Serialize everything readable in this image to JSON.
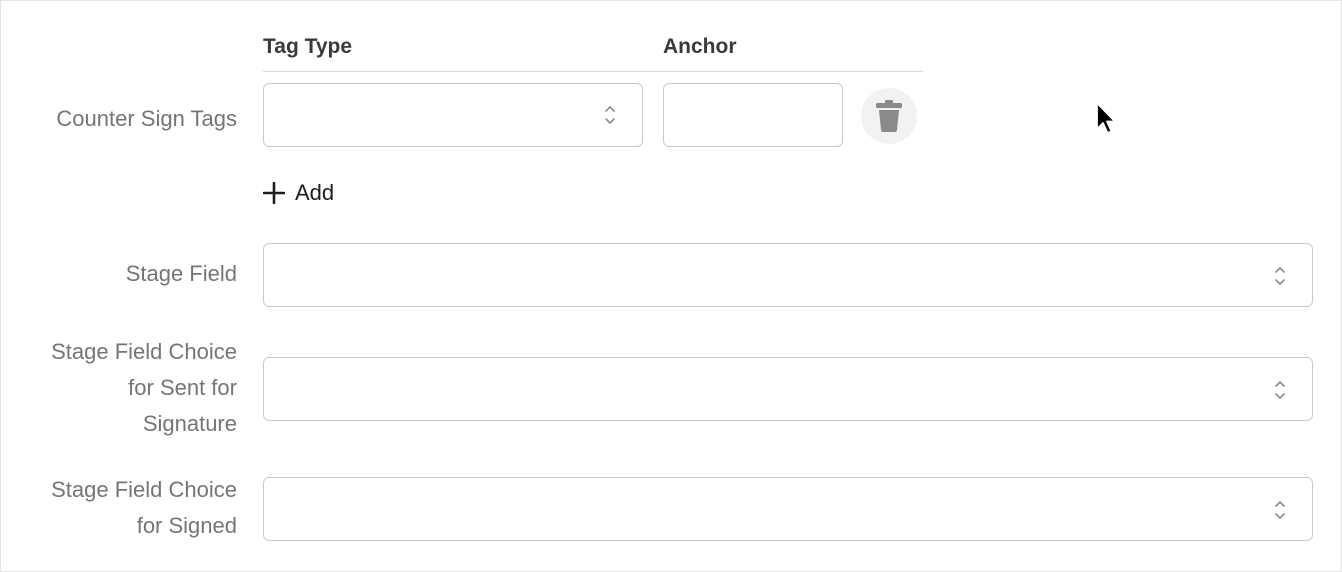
{
  "headers": {
    "tag_type": "Tag Type",
    "anchor": "Anchor"
  },
  "counter_sign": {
    "label": "Counter Sign Tags",
    "tag_type_value": "",
    "anchor_value": ""
  },
  "add_label": "Add",
  "stage_field": {
    "label": "Stage Field",
    "value": ""
  },
  "stage_choice_sent": {
    "label_lines": [
      "Stage Field Choice",
      "for Sent for",
      "Signature"
    ],
    "value": ""
  },
  "stage_choice_signed": {
    "label_lines": [
      "Stage Field Choice",
      "for Signed"
    ],
    "value": ""
  },
  "icons": {
    "delete": "trash-icon",
    "add": "plus-icon",
    "select": "chevron-updown-icon",
    "cursor": "mouse-pointer-icon"
  },
  "colors": {
    "border": "#c9c9c9",
    "label": "#757575",
    "header": "#3a3a3a",
    "trash": "#8a8a8a"
  }
}
